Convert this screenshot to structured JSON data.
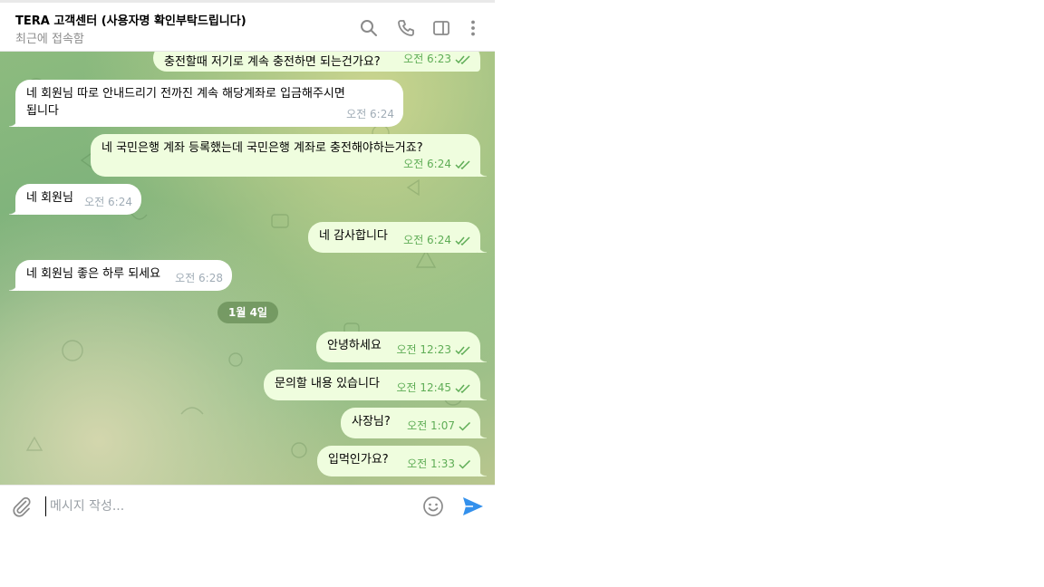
{
  "header": {
    "title": "TERA 고객센터 (사용자명 확인부탁드립니다)",
    "status": "최근에 접속함",
    "icons": [
      "search-icon",
      "phone-icon",
      "sidebar-toggle-icon",
      "more-vertical-icon"
    ]
  },
  "messages": [
    {
      "text": "충전할때 저기로 계속 충전하면 되는건가요?",
      "time": "오전 6:23",
      "dir": "out",
      "read": true
    },
    {
      "text_line1": "네 회원님 따로 안내드리기 전까진 계속 해당계좌로 입금해주시면",
      "text_line2": "됩니다",
      "time": "오전 6:24",
      "dir": "in"
    },
    {
      "text": "네 국민은행 계좌 등록했는데 국민은행 계좌로 충전해야하는거죠?",
      "time": "오전 6:24",
      "dir": "out",
      "read": true
    },
    {
      "text": "네 회원님",
      "time": "오전 6:24",
      "dir": "in"
    },
    {
      "text": "네 감사합니다",
      "time": "오전 6:24",
      "dir": "out",
      "read": true
    },
    {
      "text": "네 회원님 좋은 하루 되세요",
      "time": "오전 6:28",
      "dir": "in"
    },
    {
      "text": "안녕하세요",
      "time": "오전 12:23",
      "dir": "out",
      "read": true
    },
    {
      "text": "문의할 내용 있습니다",
      "time": "오전 12:45",
      "dir": "out",
      "read": true
    },
    {
      "text": "사장님?",
      "time": "오전 1:07",
      "dir": "out",
      "read": false
    },
    {
      "text": "입먹인가요?",
      "time": "오전 1:33",
      "dir": "out",
      "read": false
    }
  ],
  "date_divider": "1월 4일",
  "composer": {
    "placeholder": "메시지 작성...",
    "icons": [
      "paperclip-icon",
      "emoji-icon",
      "send-icon"
    ]
  },
  "colors": {
    "outgoing_bubble": "#effdde",
    "incoming_bubble": "#ffffff",
    "outgoing_meta": "#5fad56",
    "incoming_meta": "#a0acb6",
    "send_accent": "#3390ec"
  }
}
